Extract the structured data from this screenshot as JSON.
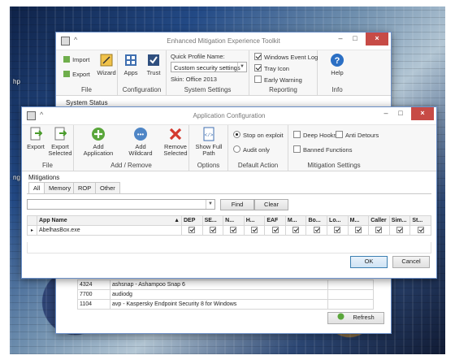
{
  "desktop": {
    "labels": [
      "hp",
      "ng"
    ]
  },
  "main_window": {
    "title": "Enhanced Mitigation Experience Toolkit",
    "file_group": {
      "label": "File",
      "import_label": "Import",
      "export_label": "Export",
      "wizard_label": "Wizard"
    },
    "config_group": {
      "label": "Configuration",
      "apps_label": "Apps",
      "trust_label": "Trust"
    },
    "system_settings": {
      "label": "System Settings",
      "quick_profile_label": "Quick Profile Name:",
      "profile_value": "Custom security settings",
      "skin_label": "Skin: Office 2013"
    },
    "reporting": {
      "label": "Reporting",
      "items": [
        {
          "label": "Windows Event Log",
          "checked": true
        },
        {
          "label": "Tray Icon",
          "checked": true
        },
        {
          "label": "Early Warning",
          "checked": false
        }
      ]
    },
    "info_group": {
      "label": "Info",
      "help_label": "Help"
    },
    "system_status_label": "System Status",
    "processes": [
      {
        "pid": "4324",
        "name": "ashsnap - Ashampoo Snap 6"
      },
      {
        "pid": "7700",
        "name": "audiodg"
      },
      {
        "pid": "1104",
        "name": "avp - Kaspersky Endpoint Security 8 for Windows"
      }
    ],
    "refresh_label": "Refresh"
  },
  "dialog": {
    "title": "Application Configuration",
    "file_group": {
      "label": "File",
      "export_label": "Export",
      "export_selected_label": "Export Selected"
    },
    "addremove_group": {
      "label": "Add / Remove",
      "add_app_label": "Add Application",
      "add_wildcard_label": "Add Wildcard",
      "remove_selected_label": "Remove Selected"
    },
    "options_group": {
      "label": "Options",
      "show_full_path_label": "Show Full Path"
    },
    "default_action": {
      "label": "Default Action",
      "stop_label": "Stop on exploit",
      "audit_label": "Audit only",
      "selected": "stop"
    },
    "mitigation_settings": {
      "label": "Mitigation Settings",
      "deep_hooks_label": "Deep Hooks",
      "anti_detours_label": "Anti Detours",
      "banned_functions_label": "Banned Functions"
    },
    "mitigations_label": "Mitigations",
    "tabs": [
      "All",
      "Memory",
      "ROP",
      "Other"
    ],
    "active_tab": "All",
    "search_placeholder": "",
    "find_label": "Find",
    "clear_label": "Clear",
    "columns": [
      "App Name",
      "DEP",
      "SE...",
      "N...",
      "H...",
      "EAF",
      "M...",
      "Bo...",
      "Lo...",
      "M...",
      "Caller",
      "Sim...",
      "St..."
    ],
    "rows": [
      {
        "app": "AbelhasBox.exe"
      }
    ],
    "ok_label": "OK",
    "cancel_label": "Cancel"
  }
}
